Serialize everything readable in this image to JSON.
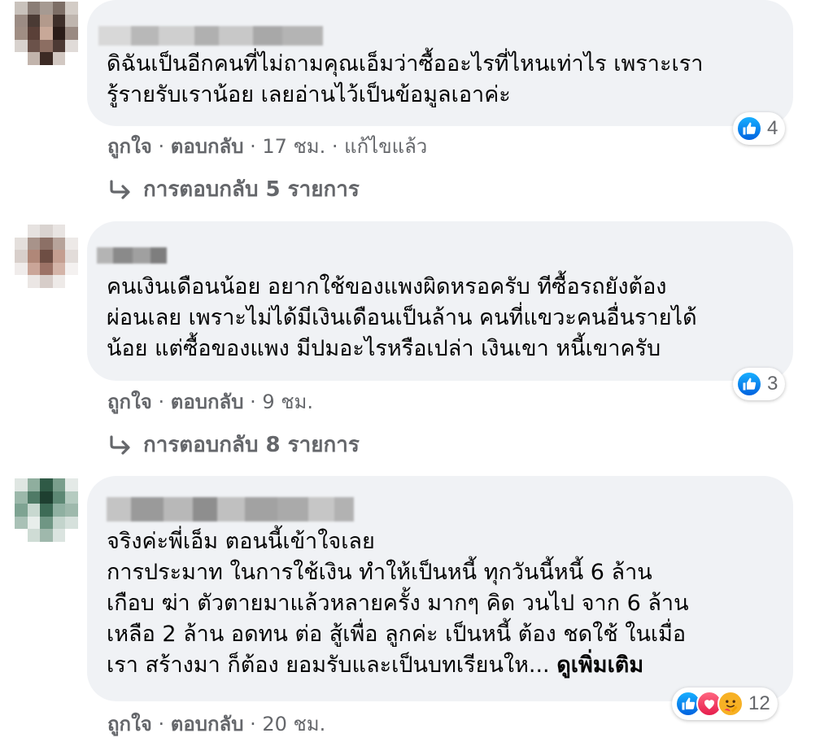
{
  "comments": [
    {
      "text_lines": [
        "ดิฉันเป็นอีกคนที่ไม่ถามคุณเอ็มว่าซื้ออะไรที่ไหนเท่าไร เพราะเรา",
        "รู้รายรับเราน้อย เลยอ่านไว้เป็นข้อมูลเอาค่ะ"
      ],
      "reaction_count": "4",
      "like_label": "ถูกใจ",
      "reply_label": "ตอบกลับ",
      "time": "17 ชม.",
      "edited": "แก้ไขแล้ว",
      "replies_label": "การตอบกลับ 5 รายการ"
    },
    {
      "text_lines": [
        "คนเงินเดือนน้อย อยากใช้ของแพงผิดหรอครับ ทีซื้อรถยังต้อง",
        "ผ่อนเลย เพราะไม่ได้มีเงินเดือนเป็นล้าน คนที่แขวะคนอื่นรายได้",
        "น้อย แต่ซื้อของแพง มีปมอะไรหรือเปล่า เงินเขา หนี้เขาครับ"
      ],
      "reaction_count": "3",
      "like_label": "ถูกใจ",
      "reply_label": "ตอบกลับ",
      "time": "9 ชม.",
      "replies_label": "การตอบกลับ 8 รายการ"
    },
    {
      "text_lines": [
        "จริงค่ะพี่เอ็ม ตอนนี้เข้าใจเลย",
        "การประมาท ในการใช้เงิน ทำให้เป็นหนี้ ทุกวันนี้หนี้ 6 ล้าน",
        "เกือบ ฆ่า ตัวตายมาแล้วหลายครั้ง มากๆ คิด วนไป จาก 6 ล้าน",
        "เหลือ 2 ล้าน อดทน ต่อ สู้เพื่อ ลูกค่ะ เป็นหนี้ ต้อง ชดใช้ ในเมื่อ",
        "เรา สร้างมา ก็ต้อง ยอมรับและเป็นบทเรียนให... "
      ],
      "see_more": "ดูเพิ่มเติม",
      "reaction_count": "12",
      "like_label": "ถูกใจ",
      "reply_label": "ตอบกลับ",
      "time": "20 ชม."
    }
  ],
  "meta_separator": " · ",
  "icons": {
    "like": "like-icon",
    "love": "love-icon",
    "care": "care-icon",
    "reply_arrow": "reply-arrow-icon"
  },
  "colors": {
    "bubble": "#f0f2f5",
    "meta_text": "#65676b",
    "like_blue": "#1877f2",
    "love_red": "#f33e58",
    "care_yellow": "#f7b125"
  }
}
